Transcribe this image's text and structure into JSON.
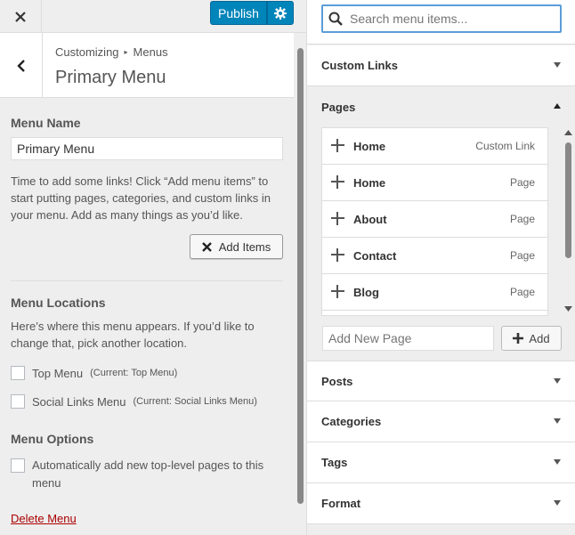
{
  "topbar": {
    "publish_label": "Publish"
  },
  "header": {
    "breadcrumb_root": "Customizing",
    "breadcrumb_current": "Menus",
    "title": "Primary Menu"
  },
  "menu": {
    "name_label": "Menu Name",
    "name_value": "Primary Menu",
    "intro": "Time to add some links! Click “Add menu items” to start putting pages, categories, and custom links in your menu. Add as many things as you’d like.",
    "add_items_label": "Add Items",
    "locations_label": "Menu Locations",
    "locations_text": "Here’s where this menu appears. If you’d like to change that, pick another location.",
    "loc_top": "Top Menu",
    "loc_top_current": "(Current: Top Menu)",
    "loc_social": "Social Links Menu",
    "loc_social_current": "(Current: Social Links Menu)",
    "options_label": "Menu Options",
    "auto_add": "Automatically add new top-level pages to this menu",
    "delete_label": "Delete Menu"
  },
  "search": {
    "placeholder": "Search menu items..."
  },
  "sections": {
    "custom_links": "Custom Links",
    "pages": "Pages",
    "posts": "Posts",
    "categories": "Categories",
    "tags": "Tags",
    "format": "Format"
  },
  "pages": [
    {
      "name": "Home",
      "type": "Custom Link"
    },
    {
      "name": "Home",
      "type": "Page"
    },
    {
      "name": "About",
      "type": "Page"
    },
    {
      "name": "Contact",
      "type": "Page"
    },
    {
      "name": "Blog",
      "type": "Page"
    }
  ],
  "add_page": {
    "placeholder": "Add New Page",
    "button": "Add"
  },
  "colors": {
    "accent": "#0085ba",
    "focus": "#5b9dd9",
    "delete": "#aa0000"
  }
}
